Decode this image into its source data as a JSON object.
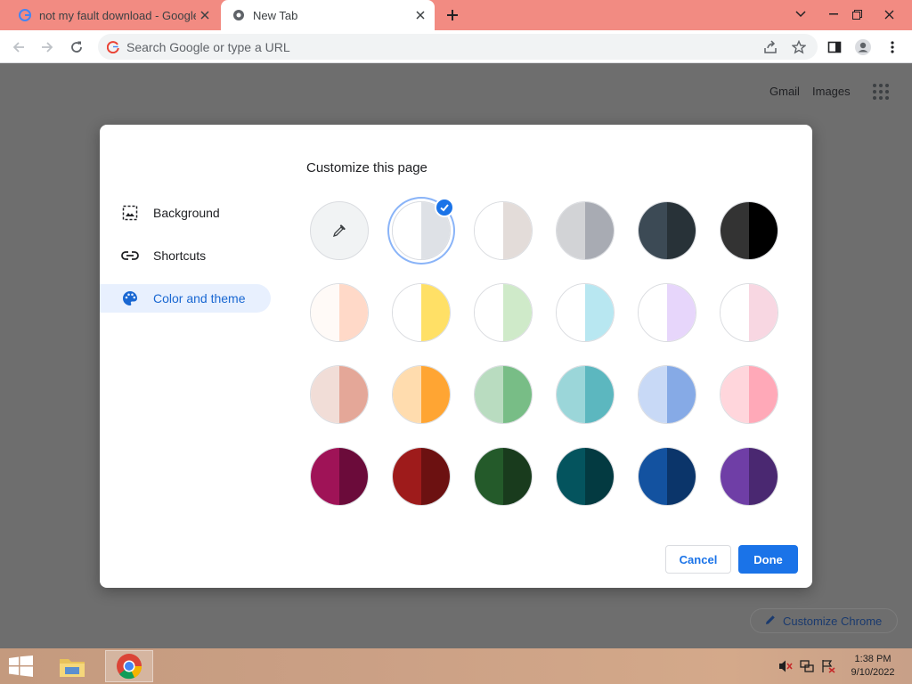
{
  "tabs": [
    {
      "title": "not my fault download - Google",
      "close": "close"
    },
    {
      "title": "New Tab",
      "close": "close"
    }
  ],
  "omnibox": {
    "placeholder": "Search Google or type a URL"
  },
  "ntp": {
    "gmail": "Gmail",
    "images": "Images",
    "customize_chrome": "Customize Chrome"
  },
  "dialog": {
    "title": "Customize this page",
    "menu": [
      {
        "label": "Background",
        "icon": "image-icon"
      },
      {
        "label": "Shortcuts",
        "icon": "link-icon"
      },
      {
        "label": "Color and theme",
        "icon": "palette-icon",
        "selected": true
      }
    ],
    "swatches": [
      [
        "custom",
        [
          "#ffffff",
          "#dee1e6"
        ],
        [
          "#ffffff",
          "#e3dcd9"
        ],
        [
          "#d2d3d6",
          "#a8abb3"
        ],
        [
          "#3c4a55",
          "#283238"
        ],
        [
          "#333333",
          "#000000"
        ]
      ],
      [
        [
          "#fffaf7",
          "#ffd9c8"
        ],
        [
          "#ffffff",
          "#ffe066"
        ],
        [
          "#ffffff",
          "#cfeac9"
        ],
        [
          "#ffffff",
          "#b8e7f1"
        ],
        [
          "#ffffff",
          "#e7d6fb"
        ],
        [
          "#ffffff",
          "#f8d7e2"
        ]
      ],
      [
        [
          "#f1ddd7",
          "#e4a798"
        ],
        [
          "#ffdcae",
          "#ffa533"
        ],
        [
          "#b9dcc0",
          "#78bd86"
        ],
        [
          "#9bd6d9",
          "#5cb7bf"
        ],
        [
          "#c8d9f6",
          "#86aae6"
        ],
        [
          "#ffd6dc",
          "#ffa9b8"
        ]
      ],
      [
        [
          "#9f1357",
          "#6b0b3a"
        ],
        [
          "#9e1b1b",
          "#6c1111"
        ],
        [
          "#245a2a",
          "#193b1d"
        ],
        [
          "#04545e",
          "#033a41"
        ],
        [
          "#1352a0",
          "#0b356a"
        ],
        [
          "#6f3ea6",
          "#4a2871"
        ]
      ]
    ],
    "selected_swatch": "row0-col1",
    "cancel_label": "Cancel",
    "done_label": "Done"
  },
  "taskbar": {
    "time": "1:38 PM",
    "date": "9/10/2022"
  },
  "colors": {
    "accent": "#1a73e8",
    "tabstrip": "#f28b82"
  }
}
